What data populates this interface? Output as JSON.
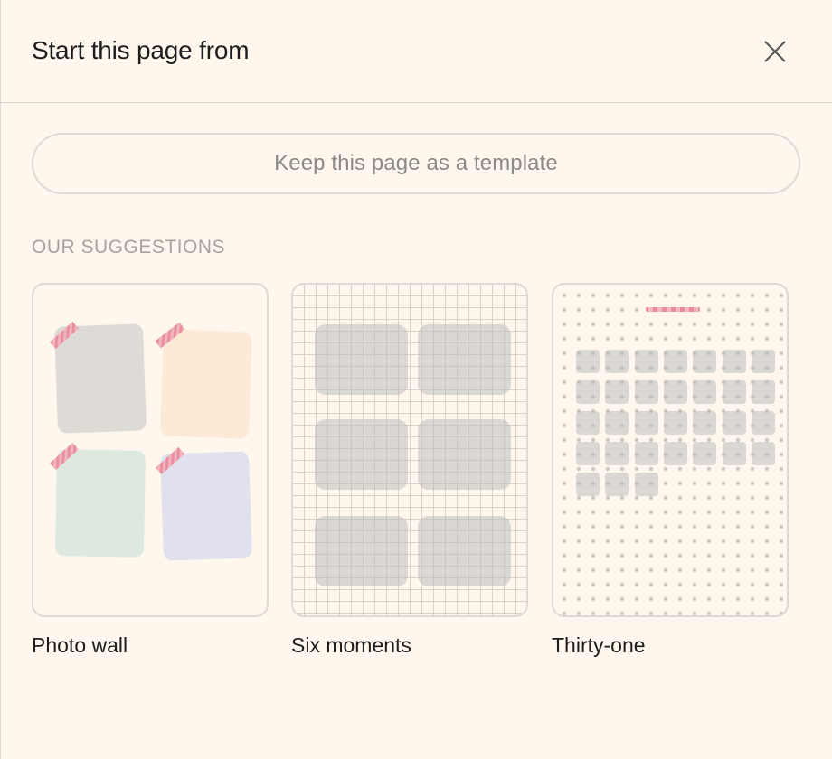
{
  "header": {
    "title": "Start this page from"
  },
  "actions": {
    "keep_template_label": "Keep this page as a template"
  },
  "suggestions": {
    "section_label": "OUR SUGGESTIONS",
    "items": [
      {
        "label": "Photo wall"
      },
      {
        "label": "Six moments"
      },
      {
        "label": "Thirty-one"
      }
    ]
  },
  "colors": {
    "background": "#fff7ee",
    "photo_gray": "#dedad5",
    "photo_peach": "#fdead6",
    "photo_mint": "#dde8df",
    "photo_lavender": "#e1e1ed",
    "tape_pink": "#e88a9a"
  },
  "icons": {
    "close": "close-icon"
  }
}
